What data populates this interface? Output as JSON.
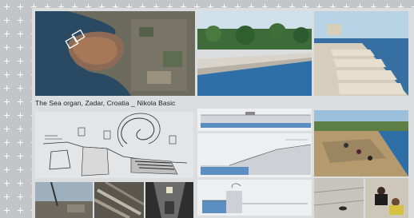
{
  "title_caption": "The Sea organ, Zadar, Croatia _ Nikola Basic",
  "icons": {
    "background_pattern": "cross-grid-pattern"
  },
  "colors": {
    "board": "#dcdddf",
    "sea": "#2f6fa8",
    "stone": "#cfc9bd"
  }
}
